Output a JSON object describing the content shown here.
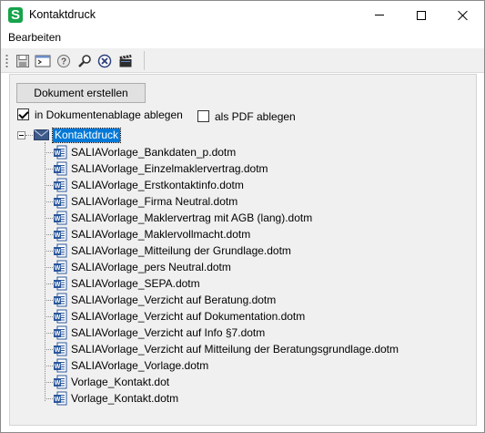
{
  "window": {
    "title": "Kontaktdruck",
    "app_icon_letter": "S"
  },
  "menu": {
    "items": [
      "Bearbeiten"
    ]
  },
  "toolbar": {
    "icons": [
      "save-icon",
      "terminal-icon",
      "help-icon",
      "search-icon",
      "cancel-icon",
      "clapperboard-icon"
    ]
  },
  "actions": {
    "create_document": "Dokument erstellen"
  },
  "options": {
    "archive_label": "in Dokumentenablage ablegen",
    "archive_checked": true,
    "pdf_label": "als PDF ablegen",
    "pdf_checked": false
  },
  "tree": {
    "root": "Kontaktdruck",
    "items": [
      "SALIAVorlage_Bankdaten_p.dotm",
      "SALIAVorlage_Einzelmaklervertrag.dotm",
      "SALIAVorlage_Erstkontaktinfo.dotm",
      "SALIAVorlage_Firma Neutral.dotm",
      "SALIAVorlage_Maklervertrag mit AGB (lang).dotm",
      "SALIAVorlage_Maklervollmacht.dotm",
      "SALIAVorlage_Mitteilung der Grundlage.dotm",
      "SALIAVorlage_pers Neutral.dotm",
      "SALIAVorlage_SEPA.dotm",
      "SALIAVorlage_Verzicht auf Beratung.dotm",
      "SALIAVorlage_Verzicht auf Dokumentation.dotm",
      "SALIAVorlage_Verzicht auf Info §7.dotm",
      "SALIAVorlage_Verzicht auf Mitteilung der Beratungsgrundlage.dotm",
      "SALIAVorlage_Vorlage.dotm",
      "Vorlage_Kontakt.dot",
      "Vorlage_Kontakt.dotm"
    ]
  },
  "colors": {
    "selection": "#0078d7",
    "word_blue": "#2b579a",
    "app_green": "#16a34a"
  }
}
